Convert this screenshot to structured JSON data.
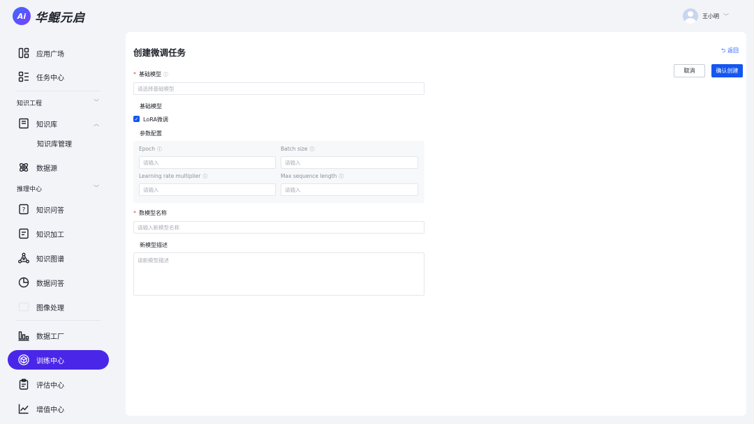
{
  "app": {
    "logo_mark": "Ai",
    "name": "华鲲元启"
  },
  "user": {
    "name": "王小明"
  },
  "sidebar": {
    "top_items": [
      {
        "label": "应用广场",
        "icon": "apps-icon"
      },
      {
        "label": "任务中心",
        "icon": "task-list-icon"
      }
    ],
    "group_knowledge": "知识工程",
    "knowledge_base": "知识库",
    "knowledge_base_manage": "知识库管理",
    "data_source": "数据源",
    "group_inference": "推理中心",
    "inference_items": [
      {
        "label": "知识问答",
        "icon": "question-icon"
      },
      {
        "label": "知识加工",
        "icon": "document-icon"
      },
      {
        "label": "知识图谱",
        "icon": "graph-icon"
      },
      {
        "label": "数据问答",
        "icon": "pie-chart-icon"
      },
      {
        "label": "图像处理",
        "icon": "image-icon"
      }
    ],
    "bottom_items": [
      {
        "label": "数据工厂",
        "icon": "bar-chart-icon"
      },
      {
        "label": "训练中心",
        "icon": "cube-icon",
        "active": true
      },
      {
        "label": "评估中心",
        "icon": "clipboard-icon"
      },
      {
        "label": "增值中心",
        "icon": "trend-icon"
      }
    ]
  },
  "main": {
    "title": "创建微调任务",
    "back": "返回",
    "cancel": "取消",
    "confirm": "确认创建",
    "base_model_label": "基础模型",
    "base_model_placeholder": "请选择基础模型",
    "base_model_section": "基础模型",
    "lora_label": "LoRA微调",
    "param_section": "参数配置",
    "params": {
      "epoch": {
        "label": "Epoch",
        "placeholder": "请输入"
      },
      "batch_size": {
        "label": "Batch size",
        "placeholder": "请输入"
      },
      "lr_multiplier": {
        "label": "Learning rate multiplier",
        "placeholder": "请输入"
      },
      "max_seq_len": {
        "label": "Max sequence length",
        "placeholder": "请输入"
      }
    },
    "new_model_name_label": "数模型名称",
    "new_model_name_placeholder": "请输入新模型名称",
    "new_model_desc_label": "新模型描述",
    "new_model_desc_placeholder": "请新模型描述"
  },
  "colors": {
    "primary": "#1456f0",
    "active_nav": "#4a27e8",
    "required": "#f53f3f"
  }
}
